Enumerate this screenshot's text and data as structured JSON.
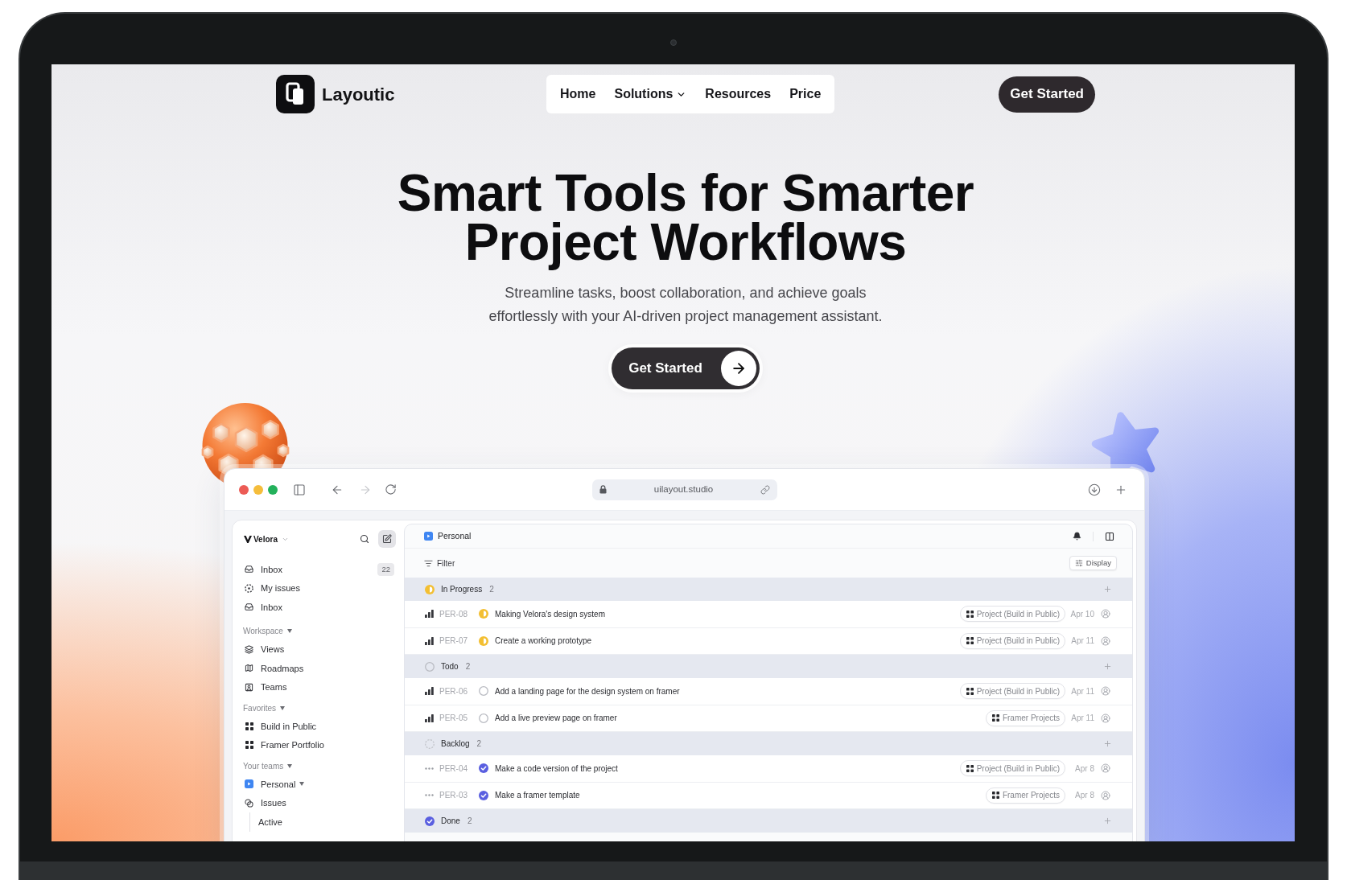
{
  "nav": {
    "logo": "Layoutic",
    "links": [
      {
        "label": "Home",
        "has_menu": false
      },
      {
        "label": "Solutions",
        "has_menu": true
      },
      {
        "label": "Resources",
        "has_menu": false
      },
      {
        "label": "Price",
        "has_menu": false
      }
    ],
    "cta": "Get Started"
  },
  "hero": {
    "title": [
      "Smart Tools for Smarter",
      "Project Workflows"
    ],
    "subtitle": [
      "Streamline tasks, boost collaboration, and achieve goals",
      "effortlessly with your AI-driven project management assistant."
    ],
    "cta": "Get Started"
  },
  "browser": {
    "url": "uilayout.studio"
  },
  "app": {
    "workspace": "Velora",
    "sidebar": {
      "items": [
        {
          "label": "Inbox",
          "badge": "22"
        },
        {
          "label": "My issues"
        },
        {
          "label": "Inbox"
        }
      ],
      "sections": [
        {
          "title": "Workspace",
          "expanded": true,
          "items": [
            {
              "label": "Views"
            },
            {
              "label": "Roadmaps"
            },
            {
              "label": "Teams"
            }
          ]
        },
        {
          "title": "Favorites",
          "expanded": true,
          "items": [
            {
              "label": "Build in Public"
            },
            {
              "label": "Framer Portfolio"
            }
          ]
        },
        {
          "title": "Your teams",
          "expanded": true,
          "items": [
            {
              "label": "Personal",
              "expanded": true,
              "children": [
                {
                  "label": "Issues",
                  "children": [
                    {
                      "label": "Active"
                    }
                  ]
                }
              ]
            }
          ]
        }
      ]
    },
    "main": {
      "team": "Personal",
      "filter": "Filter",
      "display": "Display",
      "groups": [
        {
          "kind": "progress",
          "label": "In Progress",
          "count": "2",
          "issues": [
            {
              "kind": "progress",
              "prioritized": true,
              "id": "PER-08",
              "title": "Making Velora's design system",
              "project": "Project (Build in Public)",
              "date": "Apr 10"
            },
            {
              "kind": "progress",
              "prioritized": true,
              "id": "PER-07",
              "title": "Create a working prototype",
              "project": "Project (Build in Public)",
              "date": "Apr 11"
            }
          ]
        },
        {
          "kind": "todo",
          "label": "Todo",
          "count": "2",
          "issues": [
            {
              "kind": "todo",
              "prioritized": true,
              "id": "PER-06",
              "title": "Add a landing page for the design system on framer",
              "project": "Project (Build in Public)",
              "date": "Apr 11"
            },
            {
              "kind": "todo",
              "prioritized": true,
              "id": "PER-05",
              "title": "Add a live preview page on framer",
              "project": "Framer Projects",
              "date": "Apr 11"
            }
          ]
        },
        {
          "kind": "backlog",
          "label": "Backlog",
          "count": "2",
          "issues": [
            {
              "kind": "done",
              "prioritized": false,
              "id": "PER-04",
              "title": "Make a code version of the project",
              "project": "Project (Build in Public)",
              "date": "Apr 8"
            },
            {
              "kind": "done",
              "prioritized": false,
              "id": "PER-03",
              "title": "Make a framer template",
              "project": "Framer Projects",
              "date": "Apr 8"
            }
          ]
        },
        {
          "kind": "done",
          "label": "Done",
          "count": "2"
        }
      ]
    }
  }
}
